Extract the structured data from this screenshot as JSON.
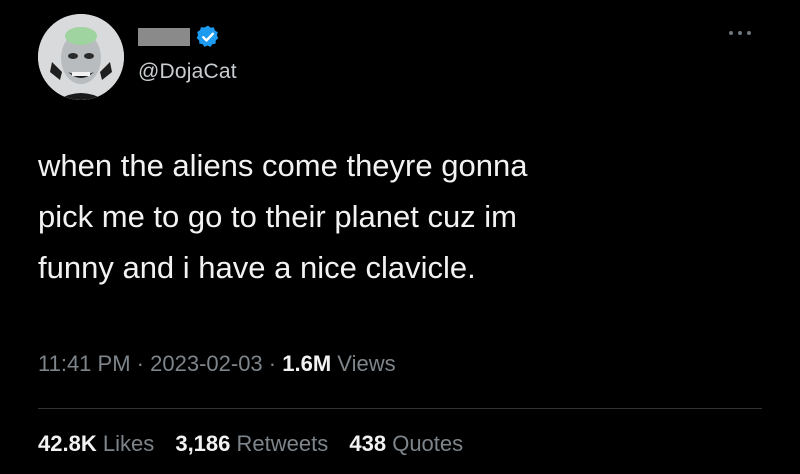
{
  "tweet": {
    "handle": "@DojaCat",
    "verified_color": "#1d9bf0",
    "more_icon": "more-horizontal-icon",
    "text_lines": [
      "when the aliens come theyre gonna",
      "pick me to go to their planet cuz im",
      "funny and i have a nice clavicle."
    ],
    "time": "11:41 PM",
    "separator": "·",
    "date": "2023-02-03",
    "views_count": "1.6M",
    "views_label": "Views",
    "stats": {
      "likes_count": "42.8K",
      "likes_label": "Likes",
      "retweets_count": "3,186",
      "retweets_label": "Retweets",
      "quotes_count": "438",
      "quotes_label": "Quotes"
    }
  },
  "colors": {
    "background": "#000000",
    "text": "#f2f2f2",
    "secondary_text": "#7d848a",
    "divider": "#2f3336"
  }
}
